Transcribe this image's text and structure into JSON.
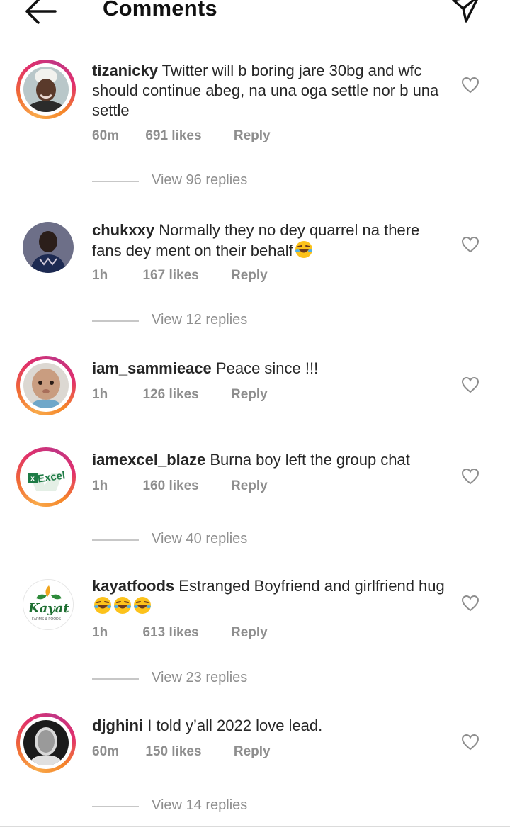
{
  "header": {
    "title": "Comments"
  },
  "comments": [
    {
      "username": "tizanicky",
      "text": "Twitter will b boring jare 30bg and wfc should continue abeg, na una oga settle nor b una settle",
      "time": "60m",
      "likes": "691 likes",
      "reply": "Reply",
      "view_replies": "View 96 replies"
    },
    {
      "username": "chukxxy",
      "text": "Normally they no dey quarrel na there fans dey ment on their behalf",
      "time": "1h",
      "likes": "167 likes",
      "reply": "Reply",
      "view_replies": "View 12 replies"
    },
    {
      "username": "iam_sammieace",
      "text": "Peace since !!!",
      "time": "1h",
      "likes": "126 likes",
      "reply": "Reply"
    },
    {
      "username": "iamexcel_blaze",
      "text": "Burna boy left the group chat",
      "time": "1h",
      "likes": "160 likes",
      "reply": "Reply",
      "view_replies": "View 40 replies",
      "avatar_logo_text": "Excel"
    },
    {
      "username": "kayatfoods",
      "text": "Estranged Boyfriend and girlfriend hug",
      "time": "1h",
      "likes": "613 likes",
      "reply": "Reply",
      "view_replies": "View 23 replies",
      "avatar_logo_text": "Kayat",
      "avatar_logo_subtext": "FARMS & FOODS"
    },
    {
      "username": "djghini",
      "text": "I told y’all 2022 love lead.",
      "time": "60m",
      "likes": "150 likes",
      "reply": "Reply",
      "view_replies": "View 14 replies"
    }
  ],
  "colors": {
    "text": "#262626",
    "secondary": "#8e8e8e",
    "divider": "#c7c7c7",
    "story_ring": [
      "#f9a94a",
      "#e1306c",
      "#c13584"
    ]
  },
  "icons": {
    "back": "arrow-left-icon",
    "send": "paper-plane-icon",
    "like": "heart-outline-icon",
    "emoji": "face-with-tears-of-joy"
  }
}
